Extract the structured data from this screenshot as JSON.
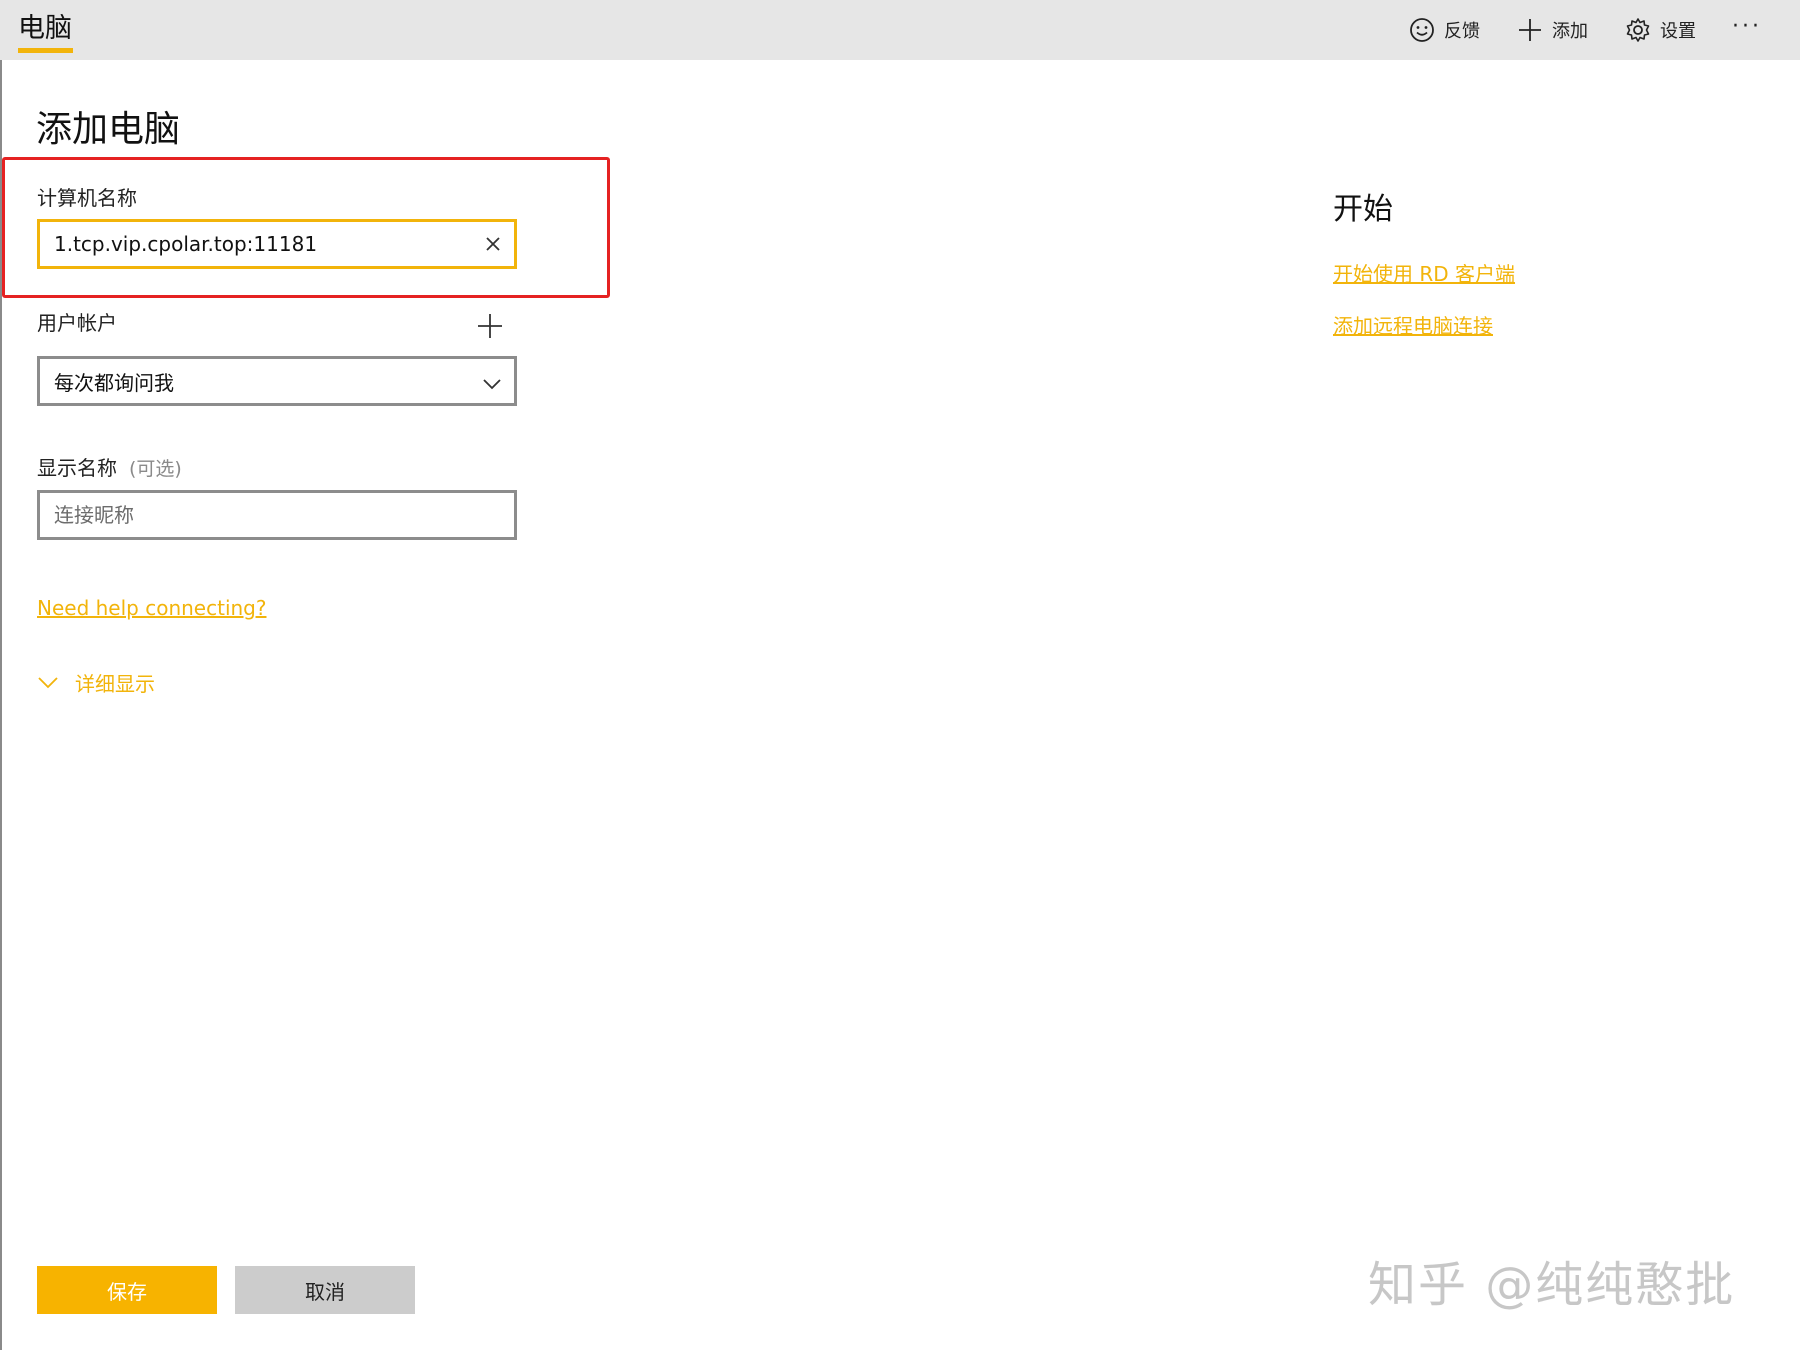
{
  "titlebar": {
    "app_title": "电脑",
    "commands": [
      {
        "label": "反馈",
        "icon": "smiley-icon"
      },
      {
        "label": "添加",
        "icon": "plus-icon"
      },
      {
        "label": "设置",
        "icon": "gear-icon"
      }
    ],
    "more_label": "···"
  },
  "page": {
    "title": "添加电脑"
  },
  "form": {
    "computer_name": {
      "label": "计算机名称",
      "value": "1.tcp.vip.cpolar.top:11181"
    },
    "user_account": {
      "label": "用户帐户",
      "selected": "每次都询问我"
    },
    "display_name": {
      "label": "显示名称",
      "optional": "(可选)",
      "placeholder": "连接昵称"
    },
    "help_link": "Need help connecting?",
    "expander_label": "详细显示"
  },
  "sidebar": {
    "heading": "开始",
    "links": [
      "开始使用 RD 客户端",
      "添加远程电脑连接"
    ]
  },
  "actions": {
    "save": "保存",
    "cancel": "取消"
  },
  "watermark": "知乎 @纯纯憨批",
  "colors": {
    "accent": "#f2b40b",
    "highlight": "#e52222",
    "titlebar_bg": "#e6e6e6"
  }
}
